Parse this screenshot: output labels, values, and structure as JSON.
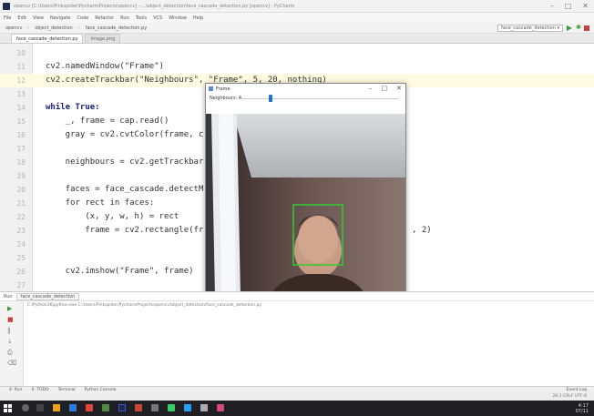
{
  "window": {
    "title": "opencv [C:\\Users\\Pinkspider\\PycharmProjects\\opencv] - ...\\object_detection\\face_cascade_detection.py [opencv] - PyCharm"
  },
  "menu": [
    "File",
    "Edit",
    "View",
    "Navigate",
    "Code",
    "Refactor",
    "Run",
    "Tools",
    "VCS",
    "Window",
    "Help"
  ],
  "breadcrumbs": [
    "opencv",
    "object_detection",
    "face_cascade_detection.py"
  ],
  "run_config": "face_cascade_detection",
  "editor_tabs": [
    {
      "label": "face_cascade_detection.py",
      "active": true
    },
    {
      "label": "image.png",
      "active": false
    }
  ],
  "code": {
    "lines": [
      {
        "n": "10",
        "text": ""
      },
      {
        "n": "11",
        "text": "cv2.namedWindow(\"Frame\")"
      },
      {
        "n": "12",
        "text": "cv2.createTrackbar(\"Neighbours\", \"Frame\", 5, 20, nothing)"
      },
      {
        "n": "13",
        "text": ""
      },
      {
        "n": "14",
        "text": "while True:"
      },
      {
        "n": "15",
        "text": "    _, frame = cap.read()"
      },
      {
        "n": "16",
        "text": "    gray = cv2.cvtColor(frame, c"
      },
      {
        "n": "17",
        "text": ""
      },
      {
        "n": "18",
        "text": "    neighbours = cv2.getTrackbar"
      },
      {
        "n": "19",
        "text": ""
      },
      {
        "n": "20",
        "text": "    faces = face_cascade.detectM"
      },
      {
        "n": "21",
        "text": "    for rect in faces:"
      },
      {
        "n": "22",
        "text": "        (x, y, w, h) = rect"
      },
      {
        "n": "23",
        "text": "        frame = cv2.rectangle(fr"
      },
      {
        "n": "24",
        "text": ""
      },
      {
        "n": "25",
        "text": ""
      },
      {
        "n": "26",
        "text": "    cv2.imshow(\"Frame\", frame)"
      },
      {
        "n": "27",
        "text": ""
      }
    ],
    "trailing_fragment": ", 2)"
  },
  "frame_window": {
    "title": "Frame",
    "trackbar_label": "Neighbours: 4",
    "trackbar_value": 4,
    "trackbar_max": 20
  },
  "run_panel": {
    "tab_label": "face_cascade_detection",
    "header_label": "Run",
    "console": "C:\\Python36\\python.exe C:/Users/Pinkspider/PycharmProjects/opencv/object_detection/face_cascade_detection.py"
  },
  "status_tabs": [
    "4: Run",
    "6: TODO",
    "Terminal",
    "Python Console"
  ],
  "status_right": "Event Log",
  "status_line": "26:1  CRLF  UTF-8",
  "clock": {
    "time": "4:17",
    "date": "07/11"
  },
  "colors": {
    "accent_blue": "#1e6fd9",
    "face_box": "#33cc33",
    "highlight_line": "#fffbe0",
    "taskbar": "#1f1f24"
  }
}
